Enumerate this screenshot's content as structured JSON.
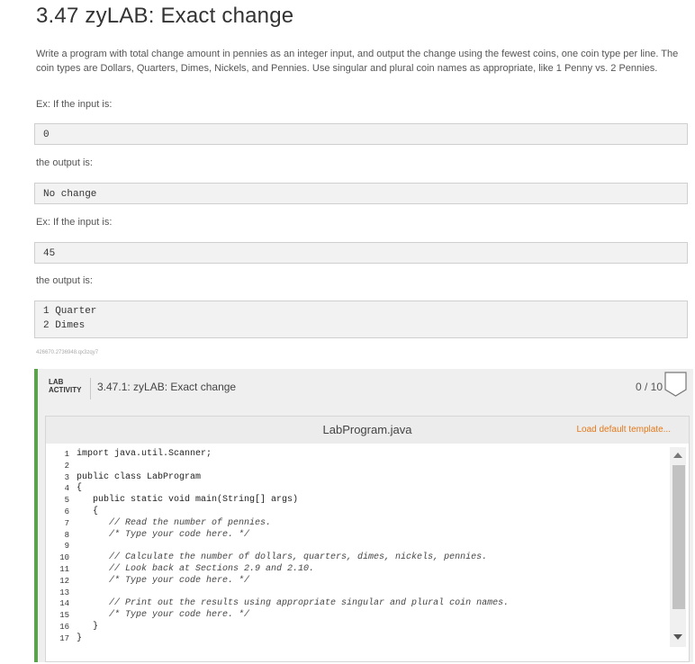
{
  "title": "3.47 zyLAB: Exact change",
  "description": "Write a program with total change amount in pennies as an integer input, and output the change using the fewest coins, one coin type per line. The coin types are Dollars, Quarters, Dimes, Nickels, and Pennies. Use singular and plural coin names as appropriate, like 1 Penny vs. 2 Pennies.",
  "examples": [
    {
      "input_label": "Ex: If the input is:",
      "input": "0",
      "output_label": "the output is:",
      "output": [
        "No change"
      ]
    },
    {
      "input_label": "Ex: If the input is:",
      "input": "45",
      "output_label": "the output is:",
      "output": [
        "1 Quarter",
        "2 Dimes"
      ]
    }
  ],
  "content_id": "426670.2736948.qx3zqy7",
  "lab": {
    "tag_line1": "LAB",
    "tag_line2": "ACTIVITY",
    "title": "3.47.1: zyLAB: Exact change",
    "score": "0 / 10",
    "filename": "LabProgram.java",
    "load_template": "Load default template...",
    "code": [
      {
        "n": "1",
        "text": "import java.util.Scanner;",
        "comment": false
      },
      {
        "n": "2",
        "text": "",
        "comment": false
      },
      {
        "n": "3",
        "text": "public class LabProgram",
        "comment": false
      },
      {
        "n": "4",
        "text": "{",
        "comment": false
      },
      {
        "n": "5",
        "text": "   public static void main(String[] args)",
        "comment": false
      },
      {
        "n": "6",
        "text": "   {",
        "comment": false
      },
      {
        "n": "7",
        "text": "      // Read the number of pennies.",
        "comment": true
      },
      {
        "n": "8",
        "text": "      /* Type your code here. */",
        "comment": true
      },
      {
        "n": "9",
        "text": "",
        "comment": false
      },
      {
        "n": "10",
        "text": "      // Calculate the number of dollars, quarters, dimes, nickels, pennies.",
        "comment": true
      },
      {
        "n": "11",
        "text": "      // Look back at Sections 2.9 and 2.10.",
        "comment": true
      },
      {
        "n": "12",
        "text": "      /* Type your code here. */",
        "comment": true
      },
      {
        "n": "13",
        "text": "",
        "comment": false
      },
      {
        "n": "14",
        "text": "      // Print out the results using appropriate singular and plural coin names.",
        "comment": true
      },
      {
        "n": "15",
        "text": "      /* Type your code here. */",
        "comment": true
      },
      {
        "n": "16",
        "text": "   }",
        "comment": false
      },
      {
        "n": "17",
        "text": "}",
        "comment": false
      }
    ]
  },
  "colors": {
    "accent_green": "#5aa34a",
    "link_orange": "#e4791a"
  }
}
